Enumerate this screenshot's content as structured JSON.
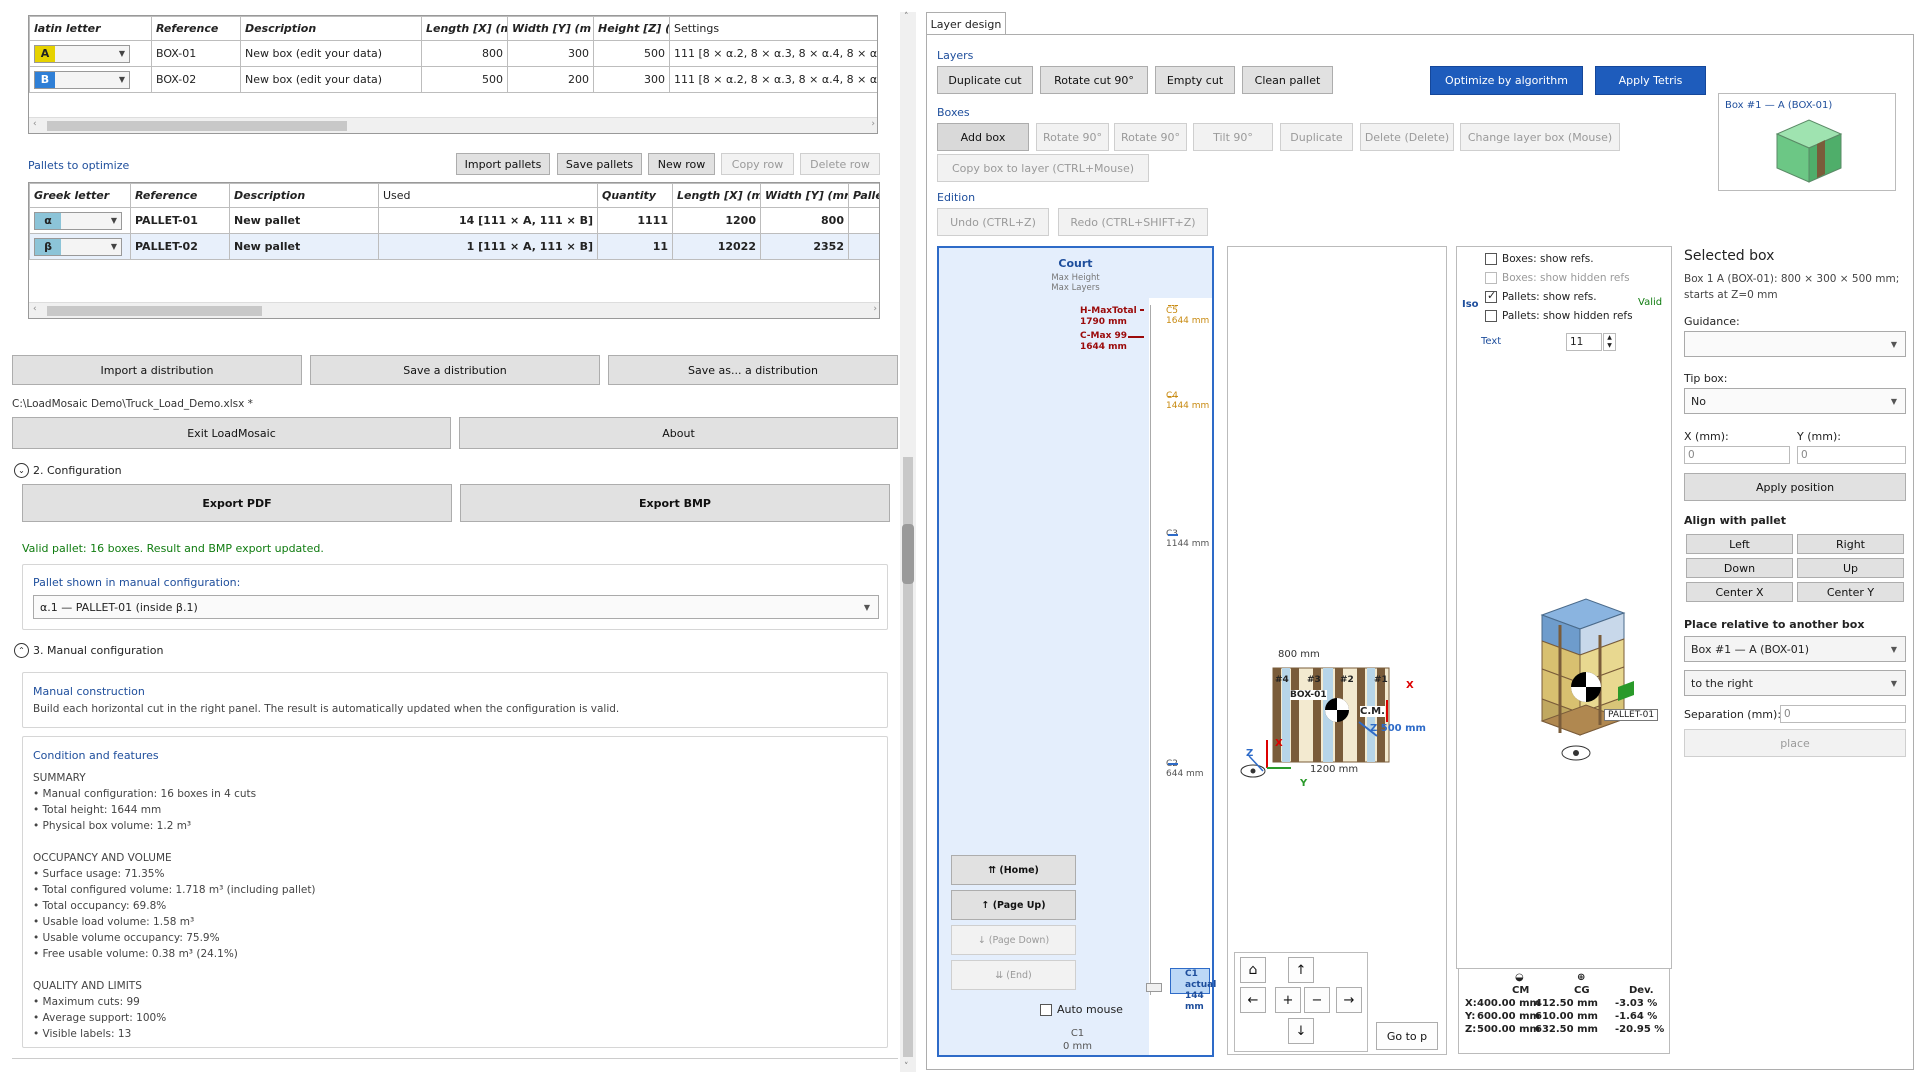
{
  "boxes_grid": {
    "headers": [
      "latin letter",
      "Reference",
      "Description",
      "Length [X] (m",
      "Width [Y] (m",
      "Height [Z] (r",
      "Settings"
    ],
    "rows": [
      {
        "letter": "A",
        "color": "#e6d200",
        "ref": "BOX-01",
        "desc": "New box (edit your data)",
        "len": "800",
        "wid": "300",
        "hei": "500",
        "settings": "111 [8 × α.2, 8 × α.3, 8 × α.4, 8 × α.5, 8"
      },
      {
        "letter": "B",
        "color": "#2f7fd6",
        "ref": "BOX-02",
        "desc": "New box (edit your data)",
        "len": "500",
        "wid": "200",
        "hei": "300",
        "settings": "111 [8 × α.2, 8 × α.3, 8 × α.4, 8 × α.5, 8"
      }
    ]
  },
  "pallets": {
    "title": "Pallets to optimize",
    "buttons": [
      "Import pallets",
      "Save pallets",
      "New row",
      "Copy row",
      "Delete row"
    ],
    "headers": [
      "Greek letter",
      "Reference",
      "Description",
      "Used",
      "Quantity",
      "Length [X] (m",
      "Width [Y] (mr",
      "Palle"
    ],
    "rows": [
      {
        "letter": "α",
        "ref": "PALLET-01",
        "desc": "New pallet",
        "used": "14 [111 × A, 111 × B]",
        "qty": "1111",
        "len": "1200",
        "wid": "800"
      },
      {
        "letter": "β",
        "ref": "PALLET-02",
        "desc": "New pallet",
        "used": "1 [111 × A, 111 × B]",
        "qty": "11",
        "len": "12022",
        "wid": "2352"
      }
    ]
  },
  "dist": {
    "import": "Import a distribution",
    "save": "Save a distribution",
    "saveas": "Save as... a distribution"
  },
  "filepath": "C:\\LoadMosaic Demo\\Truck_Load_Demo.xlsx *",
  "exit": "Exit LoadMosaic",
  "about": "About",
  "config": {
    "title": "2. Configuration",
    "export_pdf": "Export PDF",
    "export_bmp": "Export BMP",
    "status": "Valid pallet: 16 boxes. Result and BMP export updated.",
    "pallet_label": "Pallet shown in manual configuration:",
    "pallet_value": "α.1 — PALLET-01 (inside β.1)"
  },
  "manual": {
    "title": "3. Manual configuration",
    "construction_title": "Manual construction",
    "construction_text": "Build each horizontal cut in the right panel. The result is automatically updated when the configuration is valid.",
    "cond_title": "Condition and features",
    "lines": [
      "SUMMARY",
      "• Manual configuration: 16 boxes in 4 cuts",
      "• Total height: 1644 mm",
      "• Physical box volume: 1.2 m³",
      "",
      "OCCUPANCY AND VOLUME",
      "• Surface usage: 71.35%",
      "• Total configured volume: 1.718 m³ (including pallet)",
      "• Total occupancy: 69.8%",
      "• Usable load volume: 1.58 m³",
      "• Usable volume occupancy: 75.9%",
      "• Free usable volume: 0.38 m³ (24.1%)",
      "",
      "QUALITY AND LIMITS",
      "• Maximum cuts: 99",
      "• Average support: 100%",
      "• Visible labels: 13"
    ]
  },
  "right": {
    "tab": "Layer design",
    "layers_label": "Layers",
    "layers_btns": [
      "Duplicate cut",
      "Rotate cut 90°",
      "Empty cut",
      "Clean pallet"
    ],
    "optimize": "Optimize by algorithm",
    "tetris": "Apply Tetris",
    "boxes_label": "Boxes",
    "boxes_btns": [
      "Add box",
      "Rotate 90°",
      "Rotate 90°",
      "Tilt 90°",
      "Duplicate",
      "Delete (Delete)",
      "Change layer box (Mouse)"
    ],
    "copy_box": "Copy box to layer (CTRL+Mouse)",
    "edition_label": "Edition",
    "undo": "Undo (CTRL+Z)",
    "redo": "Redo (CTRL+SHIFT+Z)",
    "preview_label": "Box #1 — A (BOX-01)"
  },
  "court": {
    "title": "Court",
    "sub1": "Max Height",
    "sub2": "Max Layers",
    "hmax": "H-MaxTotal",
    "hmax_v": "1790 mm",
    "cmax": "C-Max 99",
    "cmax_v": "1644 mm",
    "levels": [
      {
        "n": "C5",
        "v": "1644 mm"
      },
      {
        "n": "C4",
        "v": "1444 mm"
      },
      {
        "n": "C3",
        "v": "1144 mm"
      },
      {
        "n": "C2",
        "v": "644 mm"
      }
    ],
    "c1": "C1 actual",
    "c1v": "144 mm",
    "nav": [
      "⇈ (Home)",
      "↑ (Page Up)",
      "↓ (Page Down)",
      "⇊ (End)"
    ],
    "auto": "Auto mouse",
    "bottom1": "C1",
    "bottom2": "0 mm"
  },
  "plan": {
    "dim_top": "800 mm",
    "dim_bottom": "1200 mm",
    "cm": "C.M.",
    "z500": "Z 500 mm",
    "xlabel": "X",
    "ylabel": "Y",
    "zlabel": "Z",
    "refs": [
      "#4",
      "#3",
      "#2",
      "#1"
    ],
    "boxref": "BOX-01",
    "goto": "Go to p"
  },
  "iso": {
    "opts": [
      "Boxes: show refs.",
      "Boxes: show hidden refs",
      "Pallets: show refs.",
      "Pallets: show hidden refs"
    ],
    "iso": "Isoı",
    "valid": "Valid",
    "text": "Text",
    "text_v": "11",
    "pallet_tag": "PALLET-01",
    "table": {
      "cm": "CM",
      "cg": "CG",
      "dev": "Dev.",
      "rows": [
        [
          "X:",
          "400.00 mm",
          "412.50 mm",
          "-3.03 %"
        ],
        [
          "Y:",
          "600.00 mm",
          "610.00 mm",
          "-1.64 %"
        ],
        [
          "Z:",
          "500.00 mm",
          "632.50 mm",
          "-20.95 %"
        ]
      ]
    }
  },
  "sel": {
    "title": "Selected box",
    "desc": "Box 1 A (BOX-01): 800 × 300 × 500 mm; starts at Z=0 mm",
    "guidance": "Guidance:",
    "tipbox": "Tip box:",
    "tipbox_v": "No",
    "x": "X (mm):",
    "y": "Y (mm):",
    "x_v": "0",
    "y_v": "0",
    "apply": "Apply position",
    "align": "Align with pallet",
    "align_btns": [
      "Left",
      "Right",
      "Down",
      "Up",
      "Center X",
      "Center Y"
    ],
    "relative": "Place relative to another box",
    "rel_box": "Box #1 — A (BOX-01)",
    "rel_pos": "to the right",
    "sep": "Separation (mm):",
    "sep_v": "0",
    "place": "place"
  }
}
